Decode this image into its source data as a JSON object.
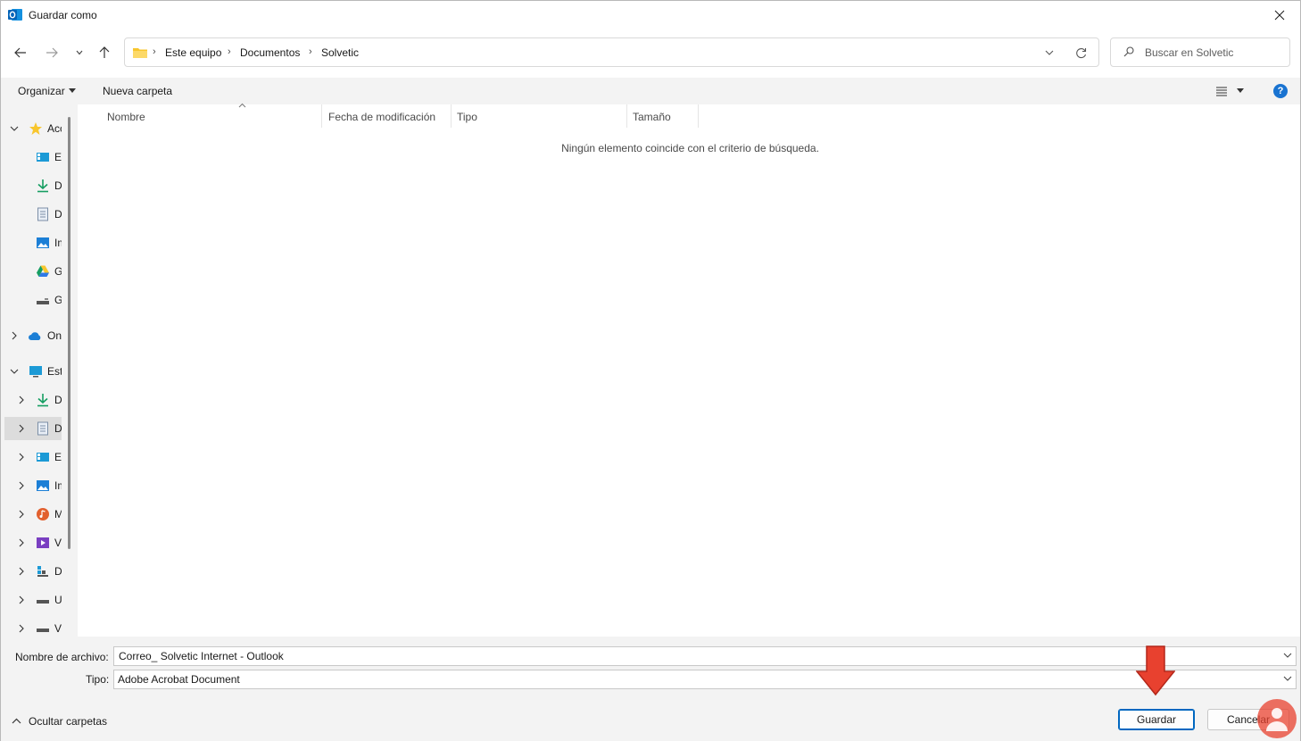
{
  "window": {
    "title": "Guardar como",
    "close_label": "✕"
  },
  "nav": {
    "back_icon": "back-arrow-icon",
    "forward_icon": "forward-arrow-icon",
    "recent_icon": "chevron-down-icon",
    "up_icon": "up-arrow-icon"
  },
  "address": {
    "crumbs": [
      "Este equipo",
      "Documentos",
      "Solvetic"
    ],
    "separator": "›"
  },
  "search": {
    "placeholder": "Buscar en Solvetic"
  },
  "toolbar": {
    "organize_label": "Organizar",
    "new_folder_label": "Nueva carpeta",
    "help_label": "?"
  },
  "tree": {
    "items": [
      {
        "label": "Acceso rápido",
        "icon": "star-icon"
      },
      {
        "label": "Escritorio",
        "icon": "desktop-icon"
      },
      {
        "label": "Descargas",
        "icon": "download-icon"
      },
      {
        "label": "Documentos",
        "icon": "document-icon"
      },
      {
        "label": "Imágenes",
        "icon": "image-icon"
      },
      {
        "label": "Google Drive",
        "icon": "google-drive-icon"
      },
      {
        "label": "G",
        "icon": "drive-icon"
      },
      {
        "label": "OneDrive",
        "icon": "cloud-icon"
      },
      {
        "label": "Este equipo",
        "icon": "computer-icon"
      },
      {
        "label": "Descargas",
        "icon": "download-icon"
      },
      {
        "label": "Documentos",
        "icon": "document-icon"
      },
      {
        "label": "Escritorio",
        "icon": "desktop-icon"
      },
      {
        "label": "Imágenes",
        "icon": "image-icon"
      },
      {
        "label": "Música",
        "icon": "music-icon"
      },
      {
        "label": "Vídeos",
        "icon": "video-icon"
      },
      {
        "label": "D",
        "icon": "grid-icon"
      },
      {
        "label": "U",
        "icon": "drive-icon"
      },
      {
        "label": "V",
        "icon": "drive-icon"
      }
    ]
  },
  "columns": {
    "name": "Nombre",
    "modified": "Fecha de modificación",
    "type": "Tipo",
    "size": "Tamaño"
  },
  "content": {
    "empty_message": "Ningún elemento coincide con el criterio de búsqueda."
  },
  "form": {
    "filename_label": "Nombre de archivo:",
    "filename_value": "Correo_ Solvetic Internet - Outlook",
    "type_label": "Tipo:",
    "type_value": "Adobe Acrobat Document"
  },
  "footer": {
    "hide_folders_label": "Ocultar carpetas",
    "save_label": "Guardar",
    "cancel_label": "Cancelar"
  },
  "colors": {
    "accent": "#0067c0",
    "help_blue": "#1973d1",
    "annotation_red": "#e8412f",
    "pane_bg": "#f3f3f3"
  }
}
